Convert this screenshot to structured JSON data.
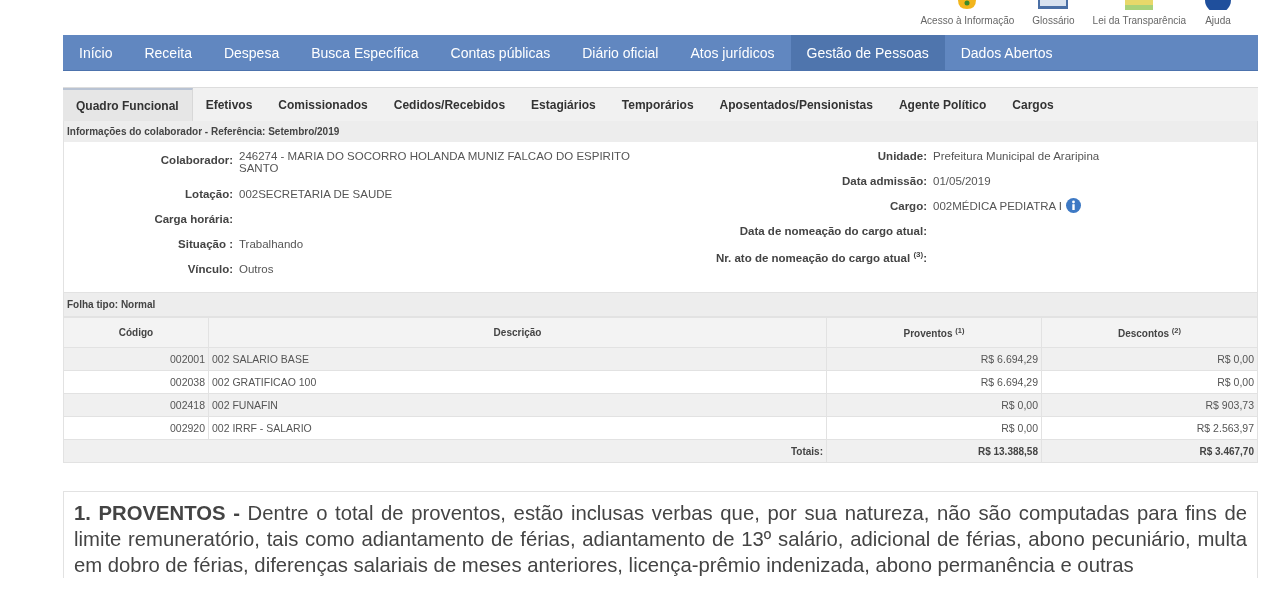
{
  "top_links": [
    {
      "label": "Acesso à Informação"
    },
    {
      "label": "Glossário"
    },
    {
      "label": "Lei da Transparência"
    },
    {
      "label": "Ajuda"
    }
  ],
  "nav": [
    {
      "label": "Início",
      "selected": false
    },
    {
      "label": "Receita",
      "selected": false
    },
    {
      "label": "Despesa",
      "selected": false
    },
    {
      "label": "Busca Específica",
      "selected": false
    },
    {
      "label": "Contas públicas",
      "selected": false
    },
    {
      "label": "Diário oficial",
      "selected": false
    },
    {
      "label": "Atos jurídicos",
      "selected": false
    },
    {
      "label": "Gestão de Pessoas",
      "selected": true
    },
    {
      "label": "Dados Abertos",
      "selected": false
    }
  ],
  "tabs": [
    {
      "label": "Quadro Funcional",
      "selected": true
    },
    {
      "label": "Efetivos",
      "selected": false
    },
    {
      "label": "Comissionados",
      "selected": false
    },
    {
      "label": "Cedidos/Recebidos",
      "selected": false
    },
    {
      "label": "Estagiários",
      "selected": false
    },
    {
      "label": "Temporários",
      "selected": false
    },
    {
      "label": "Aposentados/Pensionistas",
      "selected": false
    },
    {
      "label": "Agente Político",
      "selected": false
    },
    {
      "label": "Cargos",
      "selected": false
    }
  ],
  "info": {
    "title": "Informações do colaborador - Referência: Setembro/2019",
    "left": [
      {
        "label": "Colaborador:",
        "value": "246274 - MARIA DO SOCORRO HOLANDA MUNIZ FALCAO DO ESPIRITO SANTO"
      },
      {
        "label": "Lotação:",
        "value": "002SECRETARIA DE SAUDE"
      },
      {
        "label": "Carga horária:"
      },
      {
        "label": "Situação :",
        "value": "Trabalhando"
      },
      {
        "label": "Vínculo:",
        "value": "Outros"
      }
    ],
    "right": [
      {
        "label": "Unidade:",
        "value": "Prefeitura Municipal de Araripina",
        "info_icon": false
      },
      {
        "label": "Data admissão:",
        "value": "01/05/2019",
        "info_icon": false
      },
      {
        "label": "Cargo:",
        "value": "002MÉDICA PEDIATRA I",
        "info_icon": true
      },
      {
        "label": "Data de nomeação do cargo atual:",
        "info_icon": false
      },
      {
        "label": "Nr. ato de nomeação do cargo atual $^{(3)}$:",
        "info_icon": false
      }
    ]
  },
  "payroll": {
    "title": "Folha tipo: Normal",
    "columns": [
      "Código",
      "Descrição",
      "Proventos $^{(1)}$",
      "Descontos $^{(2)}$"
    ],
    "rows": [
      {
        "code": "002001",
        "description": "002 SALARIO BASE",
        "proventos": "R$ 6.694,29",
        "descontos": "R$ 0,00"
      },
      {
        "code": "002038",
        "description": "002 GRATIFICAO 100",
        "proventos": "R$ 6.694,29",
        "descontos": "R$ 0,00"
      },
      {
        "code": "002418",
        "description": "002 FUNAFIN",
        "proventos": "R$ 0,00",
        "descontos": "R$ 903,73"
      },
      {
        "code": "002920",
        "description": "002 IRRF - SALARIO",
        "proventos": "R$ 0,00",
        "descontos": "R$ 2.563,97"
      }
    ],
    "totals": {
      "label": "Totais:",
      "proventos": "R$ 13.388,58",
      "descontos": "R$ 3.467,70"
    }
  },
  "note": "**1. PROVENTOS -** Dentre o total de proventos, estão inclusas verbas que, por sua natureza, não são computadas para fins de limite remuneratório, tais como adiantamento de férias, adiantamento de 13º salário, adicional de férias, abono pecuniário, multa em dobro de férias, diferenças salariais de meses anteriores, licença-prêmio indenizada, abono permanência e outras"
}
